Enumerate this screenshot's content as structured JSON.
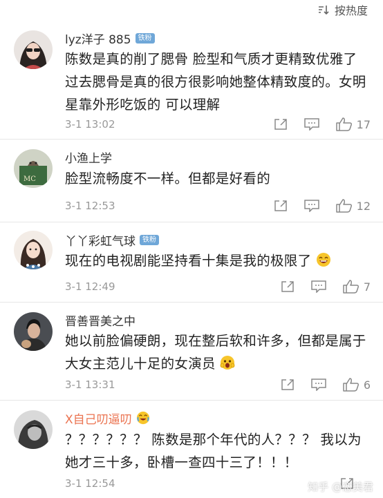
{
  "sort": {
    "label": "按热度",
    "icon": "sort-icon"
  },
  "comments": [
    {
      "username": "lyz洋子 885",
      "badge": "铁粉",
      "text": "陈数是真的削了腮骨 脸型和气质才更精致优雅了 过去腮骨是真的很方很影响她整体精致度的。女明星靠外形吃饭的 可以理解",
      "time": "3-1 13:02",
      "likes": "17"
    },
    {
      "username": "小渔上学",
      "badge": "",
      "text": "脸型流畅度不一样。但都是好看的",
      "time": "3-1 12:53",
      "likes": "12"
    },
    {
      "username": "丫丫彩虹气球",
      "badge": "铁粉",
      "text": "现在的电视剧能坚持看十集是我的极限了",
      "time": "3-1 12:49",
      "likes": "7"
    },
    {
      "username": "晋善晋美之中",
      "badge": "",
      "text": "她以前脸偏硬朗，现在整后软和许多，但都是属于大女主范儿十足的女演员",
      "time": "3-1 13:31",
      "likes": "6"
    },
    {
      "username": "X自己叨逼叨",
      "badge": "",
      "text": "？？？？？？ 陈数是那个年代的人？？？ 我以为她才三十多，卧槽一查四十三了！！！",
      "time": "3-1 12:54",
      "likes": ""
    }
  ],
  "watermark": "知乎 @恋美君",
  "colors": {
    "accent": "#eb7350",
    "badge": "#6fa7d8",
    "meta": "#999999"
  }
}
